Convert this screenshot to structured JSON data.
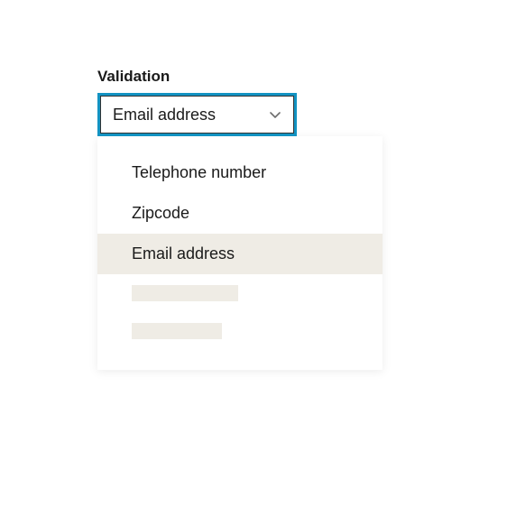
{
  "field": {
    "label": "Validation",
    "selected": "Email address"
  },
  "options": {
    "0": {
      "label": "Telephone number"
    },
    "1": {
      "label": "Zipcode"
    },
    "2": {
      "label": "Email address"
    }
  }
}
